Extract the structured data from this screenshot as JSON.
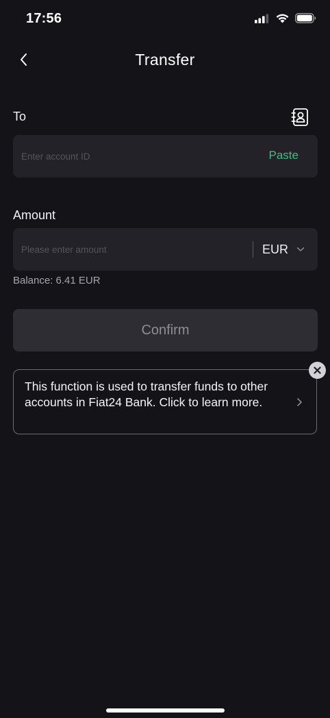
{
  "status_bar": {
    "time": "17:56",
    "icons": [
      "cellular-signal-icon",
      "wifi-icon",
      "battery-icon"
    ]
  },
  "header": {
    "title": "Transfer",
    "back_icon": "chevron-left-icon"
  },
  "to_field": {
    "label": "To",
    "placeholder": "Enter account ID",
    "value": "",
    "paste_label": "Paste",
    "contacts_icon": "contact-book-icon"
  },
  "amount_field": {
    "label": "Amount",
    "placeholder": "Please enter amount",
    "value": "",
    "currency": "EUR",
    "currency_icon": "chevron-down-icon"
  },
  "balance": "Balance: 6.41 EUR",
  "confirm_label": "Confirm",
  "info_card": {
    "text": "This function is used to transfer funds to other accounts in Fiat24 Bank. Click to learn more.",
    "chevron_icon": "chevron-right-icon",
    "close_icon": "close-icon"
  },
  "colors": {
    "background": "#141318",
    "input_background": "#232228",
    "accent_green": "#3fbf82",
    "button_disabled": "#2e2d33"
  }
}
